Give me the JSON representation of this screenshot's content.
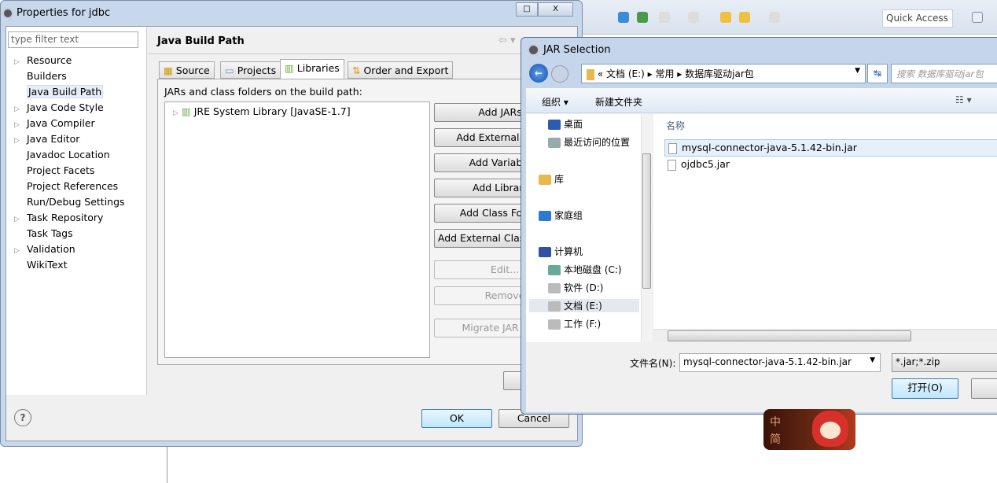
{
  "eclipse": {
    "quick_access": "Quick Access"
  },
  "properties": {
    "title": "Properties for jdbc",
    "filter_placeholder": "type filter text",
    "tree": [
      {
        "label": "Resource",
        "expandable": true
      },
      {
        "label": "Builders",
        "expandable": false
      },
      {
        "label": "Java Build Path",
        "expandable": false,
        "selected": true
      },
      {
        "label": "Java Code Style",
        "expandable": true
      },
      {
        "label": "Java Compiler",
        "expandable": true
      },
      {
        "label": "Java Editor",
        "expandable": true
      },
      {
        "label": "Javadoc Location",
        "expandable": false
      },
      {
        "label": "Project Facets",
        "expandable": false
      },
      {
        "label": "Project References",
        "expandable": false
      },
      {
        "label": "Run/Debug Settings",
        "expandable": false
      },
      {
        "label": "Task Repository",
        "expandable": true
      },
      {
        "label": "Task Tags",
        "expandable": false
      },
      {
        "label": "Validation",
        "expandable": true
      },
      {
        "label": "WikiText",
        "expandable": false
      }
    ],
    "page_title": "Java Build Path",
    "tabs": [
      "Source",
      "Projects",
      "Libraries",
      "Order and Export"
    ],
    "active_tab": "Libraries",
    "list_label": "JARs and class folders on the build path:",
    "libraries": [
      "JRE System Library [JavaSE-1.7]"
    ],
    "buttons": [
      "Add JARs...",
      "Add External JARs...",
      "Add Variable...",
      "Add Library...",
      "Add Class Folder...",
      "Add External Class Folder...",
      "Edit...",
      "Remove",
      "Migrate JAR File..."
    ],
    "ok": "OK",
    "cancel": "Cancel"
  },
  "jar_dialog": {
    "title": "JAR Selection",
    "breadcrumb": [
      "«",
      "文档 (E:)",
      "常用",
      "数据库驱动jar包"
    ],
    "search_placeholder": "搜索 数据库驱动jar包",
    "organize": "组织 ▾",
    "new_folder": "新建文件夹",
    "nav": [
      {
        "label": "桌面",
        "color": "#2a5db0"
      },
      {
        "label": "最近访问的位置",
        "color": "#9aa"
      },
      {
        "label": "库",
        "color": "#e8b84a"
      },
      {
        "label": "家庭组",
        "color": "#2d7ad0"
      },
      {
        "label": "计算机",
        "color": "#3050a0"
      },
      {
        "label": "本地磁盘 (C:)",
        "color": "#6a9"
      },
      {
        "label": "软件 (D:)",
        "color": "#bbb"
      },
      {
        "label": "文档 (E:)",
        "color": "#bbb",
        "selected": true
      },
      {
        "label": "工作 (F:)",
        "color": "#bbb"
      }
    ],
    "column_name": "名称",
    "files": [
      {
        "name": "mysql-connector-java-5.1.42-bin.jar",
        "selected": true
      },
      {
        "name": "ojdbc5.jar"
      }
    ],
    "filename_label": "文件名(N):",
    "filename_value": "mysql-connector-java-5.1.42-bin.jar",
    "filetype": "*.jar;*.zip",
    "open": "打开(O)"
  },
  "mascot": {
    "chars": [
      "中",
      "简"
    ]
  }
}
